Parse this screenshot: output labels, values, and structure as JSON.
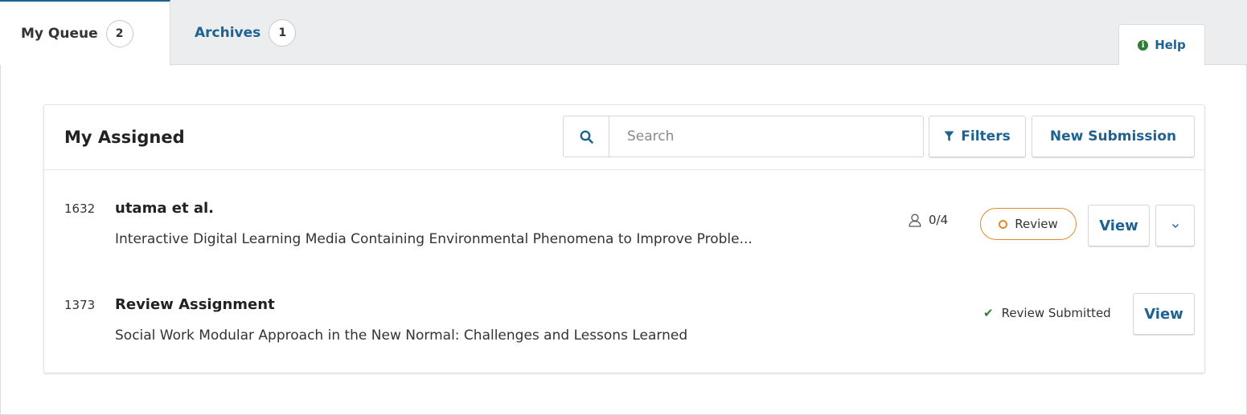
{
  "tabs": [
    {
      "label": "My Queue",
      "count": "2",
      "active": true
    },
    {
      "label": "Archives",
      "count": "1",
      "active": false
    }
  ],
  "help": {
    "label": "Help",
    "icon": "info-circle-icon"
  },
  "panel": {
    "title": "My Assigned",
    "search": {
      "placeholder": "Search",
      "value": "",
      "icon": "search-icon"
    },
    "filters_label": "Filters",
    "filters_icon": "funnel-icon",
    "new_submission_label": "New Submission"
  },
  "submissions": [
    {
      "id": "1632",
      "author": "utama et al.",
      "title": "Interactive Digital Learning Media Containing Environmental Phenomena to Improve Proble...",
      "participants": "0/4",
      "participants_icon": "user-icon",
      "stage": "Review",
      "view_label": "View",
      "expand_icon": "chevron-down-icon"
    },
    {
      "id": "1373",
      "author": "Review Assignment",
      "title": "Social Work Modular Approach in the New Normal: Challenges and Lessons Learned",
      "status": "Review Submitted",
      "status_icon": "check-icon",
      "view_label": "View"
    }
  ],
  "colors": {
    "accent": "#1e6292",
    "review": "#e08a2b",
    "success": "#2e7d32",
    "tabbar": "#ebedee"
  }
}
